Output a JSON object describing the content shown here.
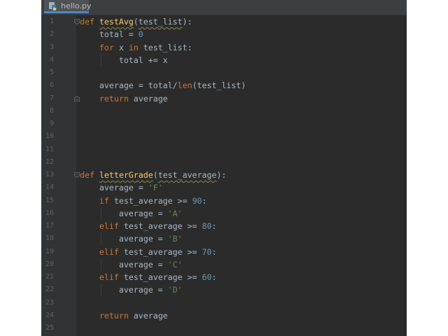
{
  "tab": {
    "filename": "hello.py",
    "icon": "python-file-icon"
  },
  "colors": {
    "background": "#2b2b2b",
    "keyword": "#cc7832",
    "function": "#ffc66d",
    "number": "#6897bb",
    "string": "#6a8759",
    "default": "#a9b7c6",
    "line_number": "#606366"
  },
  "lines": [
    {
      "n": "1",
      "tokens": [
        {
          "t": "def ",
          "c": "kw"
        },
        {
          "t": "testAvg",
          "c": "fn squig"
        },
        {
          "t": "(",
          "c": ""
        },
        {
          "t": "test_list",
          "c": "squig"
        },
        {
          "t": "):",
          "c": ""
        }
      ],
      "fold": "open"
    },
    {
      "n": "2",
      "tokens": [
        {
          "t": "    total = ",
          "c": ""
        },
        {
          "t": "0",
          "c": "num"
        }
      ]
    },
    {
      "n": "3",
      "tokens": [
        {
          "t": "    ",
          "c": ""
        },
        {
          "t": "for ",
          "c": "kw"
        },
        {
          "t": "x ",
          "c": ""
        },
        {
          "t": "in ",
          "c": "kw"
        },
        {
          "t": "test_list:",
          "c": ""
        }
      ]
    },
    {
      "n": "4",
      "tokens": [
        {
          "t": "        total += x",
          "c": ""
        }
      ]
    },
    {
      "n": "5",
      "tokens": []
    },
    {
      "n": "6",
      "tokens": [
        {
          "t": "    average = total/",
          "c": ""
        },
        {
          "t": "len",
          "c": "kw"
        },
        {
          "t": "(test_list)",
          "c": ""
        }
      ]
    },
    {
      "n": "7",
      "tokens": [
        {
          "t": "    ",
          "c": ""
        },
        {
          "t": "return ",
          "c": "kw"
        },
        {
          "t": "average",
          "c": ""
        }
      ],
      "fold": "close"
    },
    {
      "n": "8",
      "tokens": []
    },
    {
      "n": "9",
      "tokens": []
    },
    {
      "n": "10",
      "tokens": []
    },
    {
      "n": "11",
      "tokens": []
    },
    {
      "n": "12",
      "tokens": []
    },
    {
      "n": "13",
      "tokens": [
        {
          "t": "def ",
          "c": "kw"
        },
        {
          "t": "letterGrade",
          "c": "fn squig"
        },
        {
          "t": "(",
          "c": ""
        },
        {
          "t": "test_average",
          "c": "squig"
        },
        {
          "t": "):",
          "c": ""
        }
      ],
      "fold": "open"
    },
    {
      "n": "14",
      "tokens": [
        {
          "t": "    average = ",
          "c": ""
        },
        {
          "t": "'F'",
          "c": "str"
        }
      ]
    },
    {
      "n": "15",
      "tokens": [
        {
          "t": "    ",
          "c": ""
        },
        {
          "t": "if ",
          "c": "kw"
        },
        {
          "t": "test_average >= ",
          "c": ""
        },
        {
          "t": "90",
          "c": "num"
        },
        {
          "t": ":",
          "c": ""
        }
      ]
    },
    {
      "n": "16",
      "tokens": [
        {
          "t": "        average = ",
          "c": ""
        },
        {
          "t": "'A'",
          "c": "str"
        }
      ]
    },
    {
      "n": "17",
      "tokens": [
        {
          "t": "    ",
          "c": ""
        },
        {
          "t": "elif ",
          "c": "kw"
        },
        {
          "t": "test_average >= ",
          "c": ""
        },
        {
          "t": "80",
          "c": "num"
        },
        {
          "t": ":",
          "c": ""
        }
      ]
    },
    {
      "n": "18",
      "tokens": [
        {
          "t": "        average = ",
          "c": ""
        },
        {
          "t": "'B'",
          "c": "str"
        }
      ]
    },
    {
      "n": "19",
      "tokens": [
        {
          "t": "    ",
          "c": ""
        },
        {
          "t": "elif ",
          "c": "kw"
        },
        {
          "t": "test_average >= ",
          "c": ""
        },
        {
          "t": "70",
          "c": "num"
        },
        {
          "t": ":",
          "c": ""
        }
      ]
    },
    {
      "n": "20",
      "tokens": [
        {
          "t": "        average = ",
          "c": ""
        },
        {
          "t": "'C'",
          "c": "str"
        }
      ]
    },
    {
      "n": "21",
      "tokens": [
        {
          "t": "    ",
          "c": ""
        },
        {
          "t": "elif ",
          "c": "kw"
        },
        {
          "t": "test_average >= ",
          "c": ""
        },
        {
          "t": "60",
          "c": "num"
        },
        {
          "t": ":",
          "c": ""
        }
      ]
    },
    {
      "n": "22",
      "tokens": [
        {
          "t": "        average = ",
          "c": ""
        },
        {
          "t": "'D'",
          "c": "str"
        }
      ]
    },
    {
      "n": "23",
      "tokens": []
    },
    {
      "n": "24",
      "tokens": [
        {
          "t": "    ",
          "c": ""
        },
        {
          "t": "return ",
          "c": "kw"
        },
        {
          "t": "average",
          "c": ""
        }
      ]
    },
    {
      "n": "25",
      "tokens": []
    }
  ]
}
